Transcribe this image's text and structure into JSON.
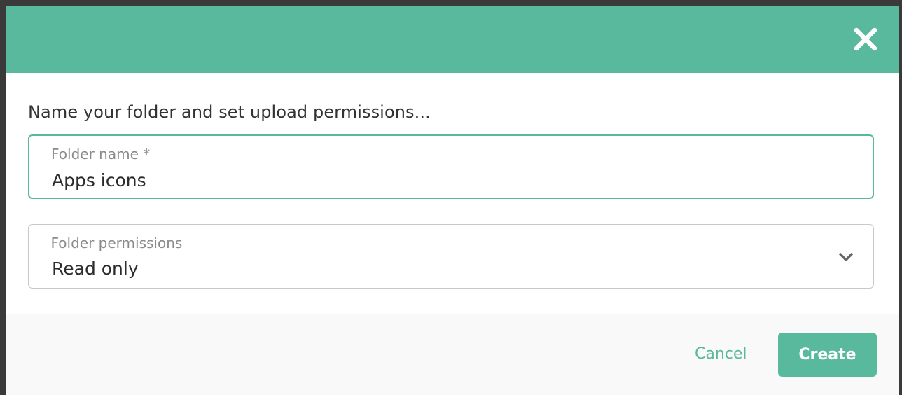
{
  "header": {
    "close_icon": "close-icon",
    "accent_color": "#59b99c"
  },
  "body": {
    "intro_text": "Name your folder and set upload permissions..."
  },
  "folder_name": {
    "label": "Folder name *",
    "value": "Apps icons"
  },
  "folder_permissions": {
    "label": "Folder permissions",
    "selected": "Read only",
    "icon": "chevron-down-icon"
  },
  "footer": {
    "cancel_label": "Cancel",
    "create_label": "Create"
  }
}
